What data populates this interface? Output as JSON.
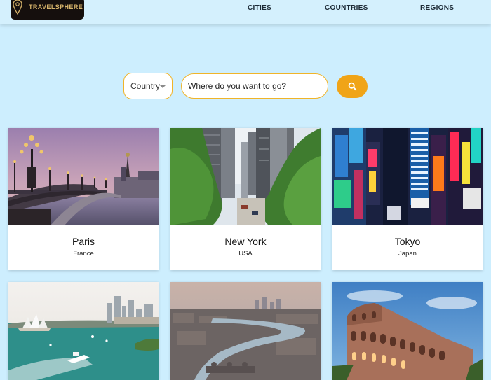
{
  "app": {
    "logo_text": "TRAVELSPHERE",
    "nav": [
      "CITIES",
      "COUNTRIES",
      "REGIONS"
    ]
  },
  "search": {
    "filter_value": "Country",
    "placeholder": "Where do you want to go?"
  },
  "cities": [
    {
      "name": "Paris",
      "country": "France"
    },
    {
      "name": "New York",
      "country": "USA"
    },
    {
      "name": "Tokyo",
      "country": "Japan"
    }
  ],
  "icons": {
    "logo": "map-pin-icon",
    "filter": "chevron-down-icon",
    "search": "search-icon"
  },
  "colors": {
    "background": "#cdeefe",
    "accent": "#f0a417",
    "logo_bg": "#150f0d",
    "logo_text": "#d6b36a"
  }
}
